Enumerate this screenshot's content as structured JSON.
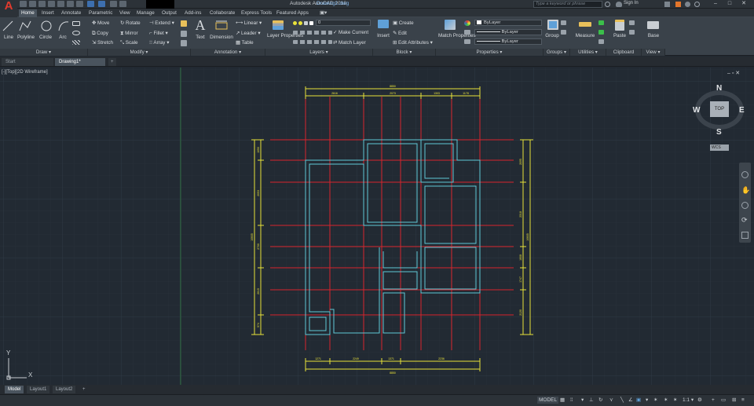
{
  "app": {
    "title": "Autodesk AutoCAD 2018",
    "document": "Drawing1.dwg",
    "search_placeholder": "Type a keyword or phrase",
    "sign_in": "Sign In",
    "logo_letter": "A"
  },
  "ribbon_tabs": [
    "Home",
    "Insert",
    "Annotate",
    "Parametric",
    "View",
    "Manage",
    "Output",
    "Add-ins",
    "Collaborate",
    "Express Tools",
    "Featured Apps"
  ],
  "draw": {
    "line": "Line",
    "polyline": "Polyline",
    "circle": "Circle",
    "arc": "Arc",
    "panel": "Draw ▾"
  },
  "modify": {
    "move": "Move",
    "rotate": "Rotate",
    "extend": "Extend ▾",
    "copy": "Copy",
    "mirror": "Mirror",
    "fillet": "Fillet ▾",
    "stretch": "Stretch",
    "scale": "Scale",
    "array": "Array ▾",
    "panel": "Modify ▾"
  },
  "annotation": {
    "text": "Text",
    "dimension": "Dimension",
    "linear": "Linear ▾",
    "leader": "Leader ▾",
    "table": "Table",
    "panel": "Annotation ▾"
  },
  "layers": {
    "properties": "Layer Properties",
    "current_layer": "0",
    "make_current": "Make Current",
    "match_layer": "Match Layer",
    "panel": "Layers ▾"
  },
  "block": {
    "insert": "Insert",
    "create": "Create",
    "edit": "Edit",
    "edit_attributes": "Edit Attributes ▾",
    "panel": "Block ▾"
  },
  "properties": {
    "match": "Match Properties",
    "color": "ByLayer",
    "linetype": "ByLayer",
    "lineweight": "ByLayer",
    "panel": "Properties ▾"
  },
  "groups": {
    "group": "Group",
    "panel": "Groups ▾"
  },
  "utilities": {
    "measure": "Measure",
    "panel": "Utilities ▾"
  },
  "clipboard": {
    "paste": "Paste",
    "panel": "Clipboard"
  },
  "view": {
    "base": "Base",
    "panel": "View ▾"
  },
  "file_tabs": [
    "Start",
    "Drawing1*"
  ],
  "viewport": {
    "label": "[-][Top][2D Wireframe]"
  },
  "viewcube": {
    "n": "N",
    "s": "S",
    "e": "E",
    "w": "W",
    "top": "TOP",
    "wcs": "WCS"
  },
  "ucs": {
    "x": "X",
    "y": "Y"
  },
  "dims": {
    "top_total": "8850",
    "top1": "2616",
    "top2": "2073",
    "top3": "1303",
    "top4": "1178",
    "bottom_total": "8850",
    "bottom1": "1271",
    "bottom2": "2249",
    "bottom3": "1371",
    "bottom4": "2236",
    "left_total": "10605",
    "left1": "1050",
    "left2": "2053",
    "left3": "2700",
    "left4": "2015",
    "left5": "574",
    "right_total": "10605",
    "right1": "2095",
    "right2": "2318",
    "right3": "1608",
    "right4": "1747",
    "right5": "2120"
  },
  "layout_tabs": [
    "Model",
    "Layout1",
    "Layout2"
  ],
  "status": {
    "model": "MODEL",
    "scale": "1:1 ▾"
  },
  "colors": {
    "grid": "#2b343e",
    "grid_major": "#313b46",
    "walls": "#5fc8d6",
    "red": "#d8242c",
    "yellow": "#e8e23a"
  }
}
